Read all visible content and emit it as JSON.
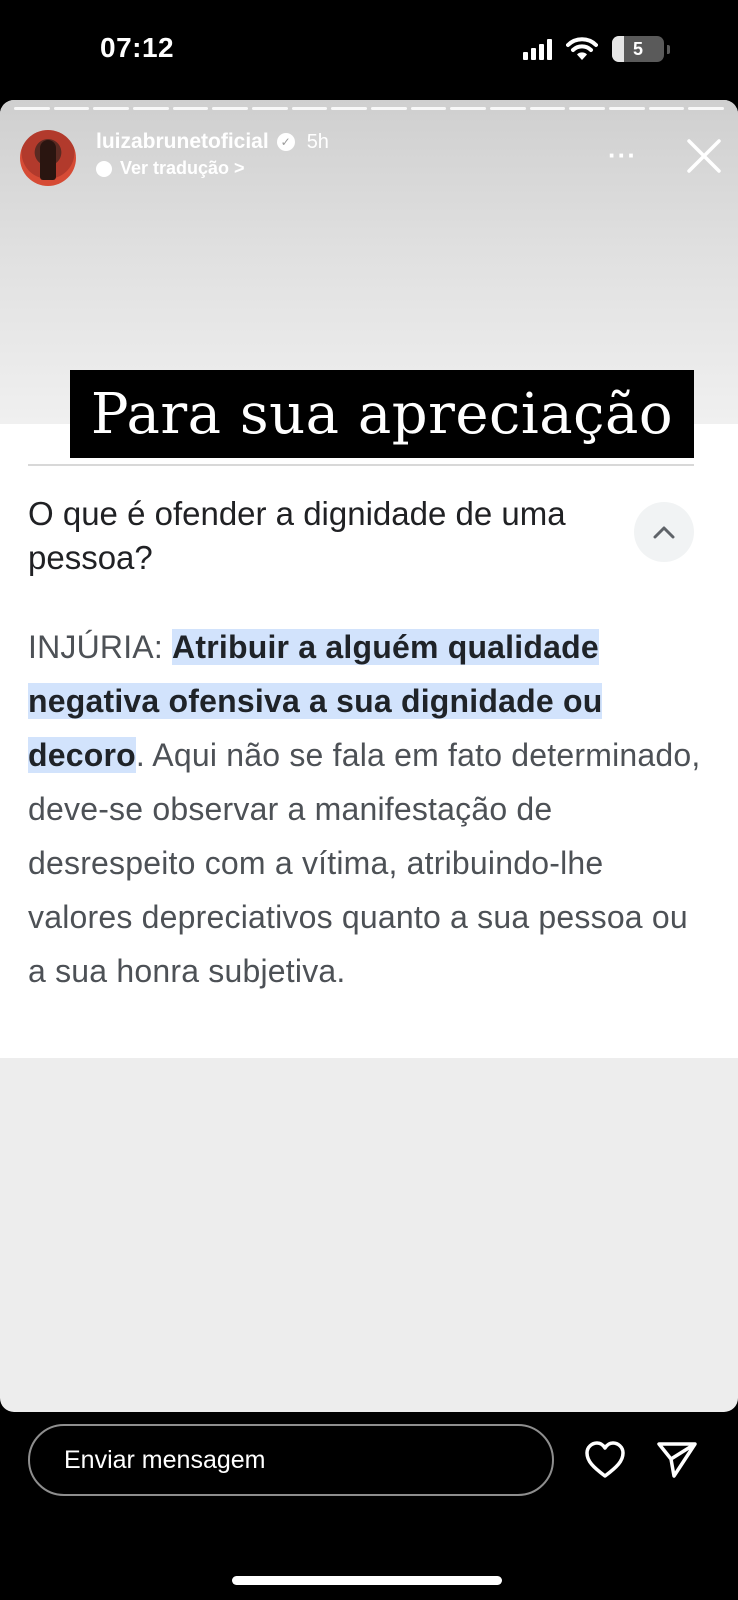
{
  "status_bar": {
    "time": "07:12",
    "battery": "5"
  },
  "story": {
    "username": "luizabrunetoficial",
    "time_ago": "5h",
    "translate": "Ver tradução >",
    "more": "···",
    "banner_title": "Para sua apreciação",
    "progress_segments": 18
  },
  "article": {
    "question": "O que é ofender a dignidade de uma pessoa?",
    "answer_prefix": "INJÚRIA: ",
    "answer_highlight": "Atribuir a alguém qualidade negativa ofensiva a sua dignidade ou decoro",
    "answer_rest": ". Aqui não se fala em fato determinado, deve-se observar a manifestação de desrespeito com a vítima, atribuindo-lhe valores depreciativos quanto a sua pessoa ou a sua honra subjetiva."
  },
  "bottom_bar": {
    "message_placeholder": "Enviar mensagem"
  },
  "icons": [
    "signal-icon",
    "wifi-icon",
    "battery-icon",
    "verified-icon",
    "translate-icon",
    "more-icon",
    "close-icon",
    "chevron-up-icon",
    "heart-icon",
    "send-icon"
  ],
  "colors": {
    "highlight": "#d2e3fc",
    "banner_bg": "#000000"
  }
}
